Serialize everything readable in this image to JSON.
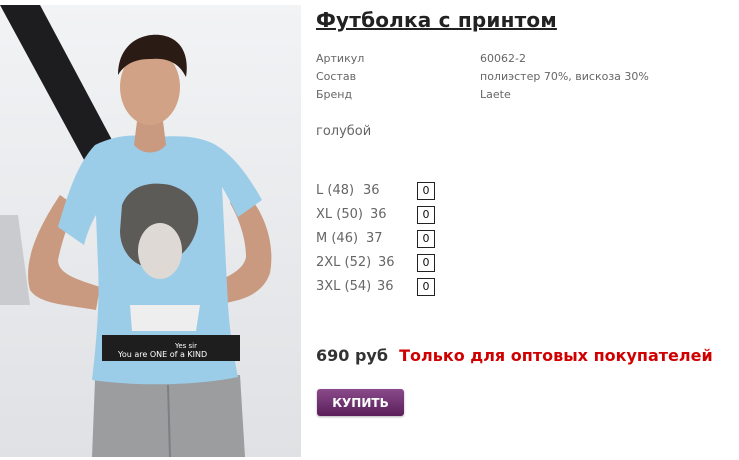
{
  "product": {
    "title": "Футболка с принтом",
    "specs": [
      {
        "label": "Артикул",
        "value": "60062-2"
      },
      {
        "label": "Состав",
        "value": "полиэстер 70%, вискоза 30%"
      },
      {
        "label": "Бренд",
        "value": "Laete"
      }
    ],
    "color": "голубой",
    "sizes": [
      {
        "label": "L (48)",
        "count": "36",
        "qty": "0"
      },
      {
        "label": "XL (50)",
        "count": "36",
        "qty": "0"
      },
      {
        "label": "M (46)",
        "count": "37",
        "qty": "0"
      },
      {
        "label": "2XL (52)",
        "count": "36",
        "qty": "0"
      },
      {
        "label": "3XL (54)",
        "count": "36",
        "qty": "0"
      }
    ],
    "price": "690 руб",
    "wholesale_note": "Только для оптовых покупателей",
    "buy_label": "КУПИТЬ",
    "photo_print_text": [
      "Yes sir",
      "You are ONE of a KIND"
    ],
    "colors": {
      "title": "#222222",
      "wholesale": "#d00000",
      "button": "#6a2a6b",
      "shirt": "#9ccde8"
    }
  }
}
